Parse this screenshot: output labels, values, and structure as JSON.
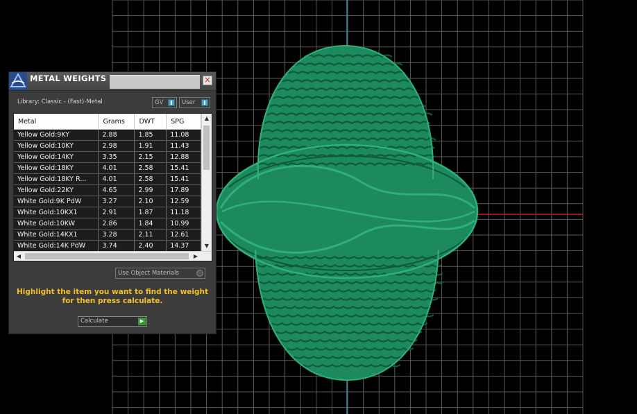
{
  "panel": {
    "title": "METAL WEIGHTS",
    "close_symbol": "×",
    "library_label": "Library: Classic - (Fast)-Metal",
    "toggles": {
      "gv_label": "GV",
      "user_label": "User"
    },
    "table": {
      "columns": [
        "Metal",
        "Grams",
        "DWT",
        "SPG"
      ],
      "rows": [
        [
          "Yellow Gold:9KY",
          "2.88",
          "1.85",
          "11.08"
        ],
        [
          "Yellow Gold:10KY",
          "2.98",
          "1.91",
          "11.43"
        ],
        [
          "Yellow Gold:14KY",
          "3.35",
          "2.15",
          "12.88"
        ],
        [
          "Yellow Gold:18KY",
          "4.01",
          "2.58",
          "15.41"
        ],
        [
          "Yellow Gold:18KY R...",
          "4.01",
          "2.58",
          "15.41"
        ],
        [
          "Yellow Gold:22KY",
          "4.65",
          "2.99",
          "17.89"
        ],
        [
          "White Gold:9K PdW",
          "3.27",
          "2.10",
          "12.59"
        ],
        [
          "White Gold:10KX1",
          "2.91",
          "1.87",
          "11.18"
        ],
        [
          "White Gold:10KW",
          "2.86",
          "1.84",
          "10.99"
        ],
        [
          "White Gold:14KX1",
          "3.28",
          "2.11",
          "12.61"
        ],
        [
          "White Gold:14K PdW",
          "3.74",
          "2.40",
          "14.37"
        ]
      ]
    },
    "use_object_materials_label": "Use Object Materials",
    "hint": "Highlight the item you want to find the weight for then press calculate.",
    "calculate_label": "Calculate"
  },
  "colors": {
    "background": "#000000",
    "grid": "#5a5a5a",
    "axis_y": "#2a8fb8",
    "axis_x": "#c02020",
    "model": "#1d8a5e",
    "hint_text": "#f2c02a"
  },
  "icons": [
    "app-logo-icon",
    "close-icon",
    "toggle-knob-icon",
    "scroll-up-icon",
    "scroll-down-icon",
    "scroll-left-icon",
    "scroll-right-icon",
    "radio-icon",
    "play-arrow-icon"
  ]
}
